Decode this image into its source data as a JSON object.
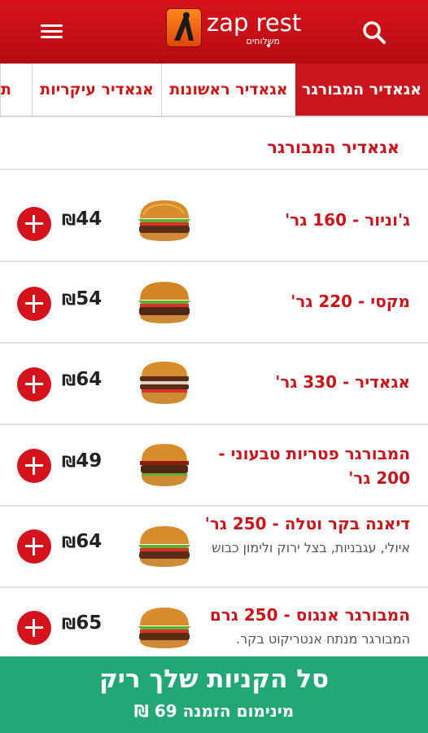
{
  "header": {
    "logo_text": "zap rest",
    "logo_subtext": "משלוחים",
    "menu_icon": "hamburger-menu-icon",
    "search_icon": "search-icon",
    "brand_color": "#c8161c"
  },
  "tabs": [
    {
      "label": "אגאדיר המבורגר",
      "active": true
    },
    {
      "label": "אגאדיר ראשונות",
      "active": false
    },
    {
      "label": "אגאדיר עיקריות",
      "active": false
    },
    {
      "label": "ת",
      "active": false
    }
  ],
  "section": {
    "title": "אגאדיר המבורגר"
  },
  "items": [
    {
      "name": "ג'וניור - 160 גר'",
      "description": "",
      "price": "44",
      "currency": "₪"
    },
    {
      "name": "מקסי - 220 גר'",
      "description": "",
      "price": "54",
      "currency": "₪"
    },
    {
      "name": "אגאדיר - 330 גר'",
      "description": "",
      "price": "64",
      "currency": "₪"
    },
    {
      "name": "המבורגר פטריות טבעוני - 200 גר'",
      "description": "",
      "price": "49",
      "currency": "₪"
    },
    {
      "name": "דיאנה בקר וטלה - 250 גר'",
      "description": "איולי, עגבניות, בצל ירוק ולימון כבוש",
      "price": "64",
      "currency": "₪"
    },
    {
      "name": "המבורגר אנגוס - 250 גרם",
      "description": "המבורגר מנתח אנטריקוט בקר.",
      "price": "65",
      "currency": "₪"
    }
  ],
  "cart": {
    "title": "סל הקניות שלך ריק",
    "minimum_order": "מינימום הזמנה 69 ₪",
    "color": "#22a775"
  }
}
